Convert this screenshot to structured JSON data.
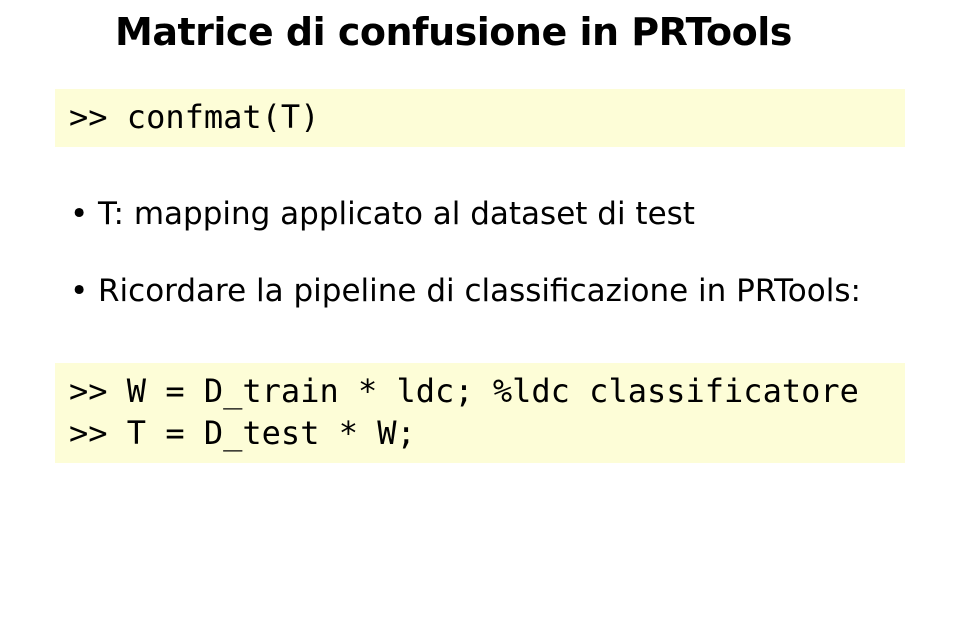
{
  "title": "Matrice di confusione in PRTools",
  "code1": {
    "line1": ">> confmat(T)"
  },
  "bullets": {
    "item1": "T: mapping applicato al dataset di test",
    "item2": "Ricordare la pipeline di classificazione in PRTools:"
  },
  "code2": {
    "line1": ">> W = D_train * ldc; %ldc classificatore",
    "line2": ">> T = D_test * W;"
  }
}
